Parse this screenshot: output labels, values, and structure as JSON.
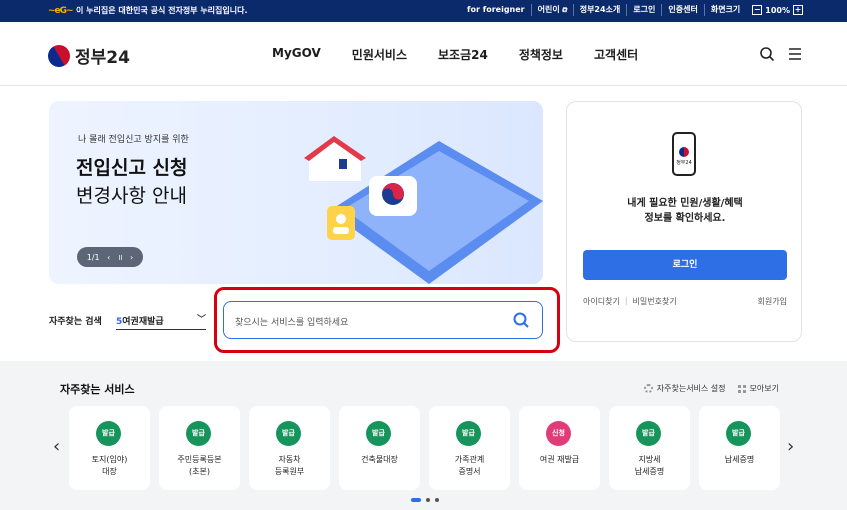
{
  "topbar": {
    "notice": "이 누리집은 대한민국 공식 전자정부 누리집입니다.",
    "links": [
      "for foreigner",
      "어린이",
      "정부24소개",
      "로그인",
      "인증센터"
    ],
    "font_size_label": "화면크기",
    "zoom_value": "100%",
    "zoom_minus": "−",
    "zoom_plus": "+"
  },
  "header": {
    "brand": "정부24",
    "nav": [
      "MyGOV",
      "민원서비스",
      "보조금24",
      "정책정보",
      "고객센터"
    ]
  },
  "hero": {
    "subtitle": "나 몰래 전입신고 방지를 위한",
    "title_line1": "전입신고 신청",
    "title_line2": "변경사항 안내",
    "pager": "1/1"
  },
  "login_box": {
    "message_line1": "내게 필요한 민원/생활/혜택",
    "message_line2": "정보를 확인하세요.",
    "phone_label": "정부24",
    "login_button": "로그인",
    "find_id": "아이디찾기",
    "find_pw": "비밀번호찾기",
    "join": "회원가입"
  },
  "search": {
    "label": "자주찾는 검색",
    "selected_num": "5",
    "selected_text": "여권재발급",
    "placeholder": "찾으시는 서비스를 입력하세요"
  },
  "services": {
    "title": "자주찾는 서비스",
    "settings": "자주찾는서비스 설정",
    "view_all": "모아보기",
    "items": [
      {
        "badge": "발급",
        "label": "토지(임야)\n대장",
        "color": "#15945b"
      },
      {
        "badge": "발급",
        "label": "주민등록등본\n(초본)",
        "color": "#15945b"
      },
      {
        "badge": "발급",
        "label": "자동차\n등록원부",
        "color": "#15945b"
      },
      {
        "badge": "발급",
        "label": "건축물대장",
        "color": "#15945b"
      },
      {
        "badge": "발급",
        "label": "가족관계\n증명서",
        "color": "#15945b"
      },
      {
        "badge": "신청",
        "label": "여권 재발급",
        "color": "#e23b7a"
      },
      {
        "badge": "발급",
        "label": "지방세\n납세증명",
        "color": "#15945b"
      },
      {
        "badge": "발급",
        "label": "납세증명",
        "color": "#15945b"
      }
    ]
  }
}
